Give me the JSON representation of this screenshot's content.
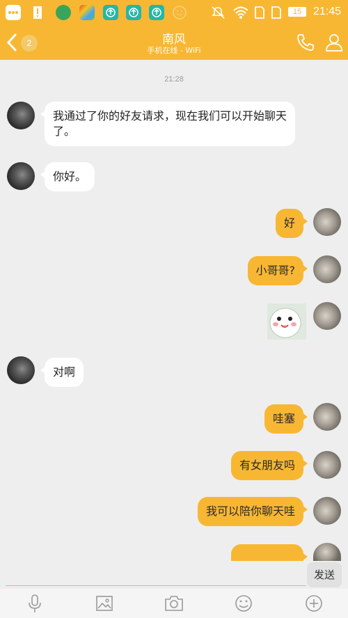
{
  "status_bar": {
    "time": "21:45",
    "battery": "15",
    "icons": [
      "message-icon",
      "alert-icon",
      "app-icon",
      "app-icon",
      "upload-icon",
      "upload-icon",
      "upload-icon",
      "smiley-icon",
      "mute-icon",
      "wifi-icon",
      "sim-icon",
      "sim-icon"
    ]
  },
  "header": {
    "back_badge": "2",
    "title": "南风",
    "subtitle": "手机在线 - WiFi"
  },
  "chat": {
    "timestamp": "21:28",
    "messages": [
      {
        "side": "left",
        "text": "我通过了你的好友请求，现在我们可以开始聊天了。"
      },
      {
        "side": "left",
        "text": "你好。"
      },
      {
        "side": "right",
        "text": "好"
      },
      {
        "side": "right",
        "text": "小哥哥?"
      },
      {
        "side": "right",
        "sticker": "smiling-face-sticker"
      },
      {
        "side": "left",
        "text": "对啊"
      },
      {
        "side": "right",
        "text": "哇塞"
      },
      {
        "side": "right",
        "text": "有女朋友吗"
      },
      {
        "side": "right",
        "text": "我可以陪你聊天哇"
      }
    ]
  },
  "input": {
    "value": "",
    "send_label": "发送"
  },
  "toolbar": {
    "icons": [
      "microphone-icon",
      "image-icon",
      "camera-icon",
      "emoji-icon",
      "plus-icon"
    ]
  },
  "colors": {
    "accent": "#f8b733",
    "background": "#eeeeee",
    "bubble_left": "#ffffff"
  }
}
